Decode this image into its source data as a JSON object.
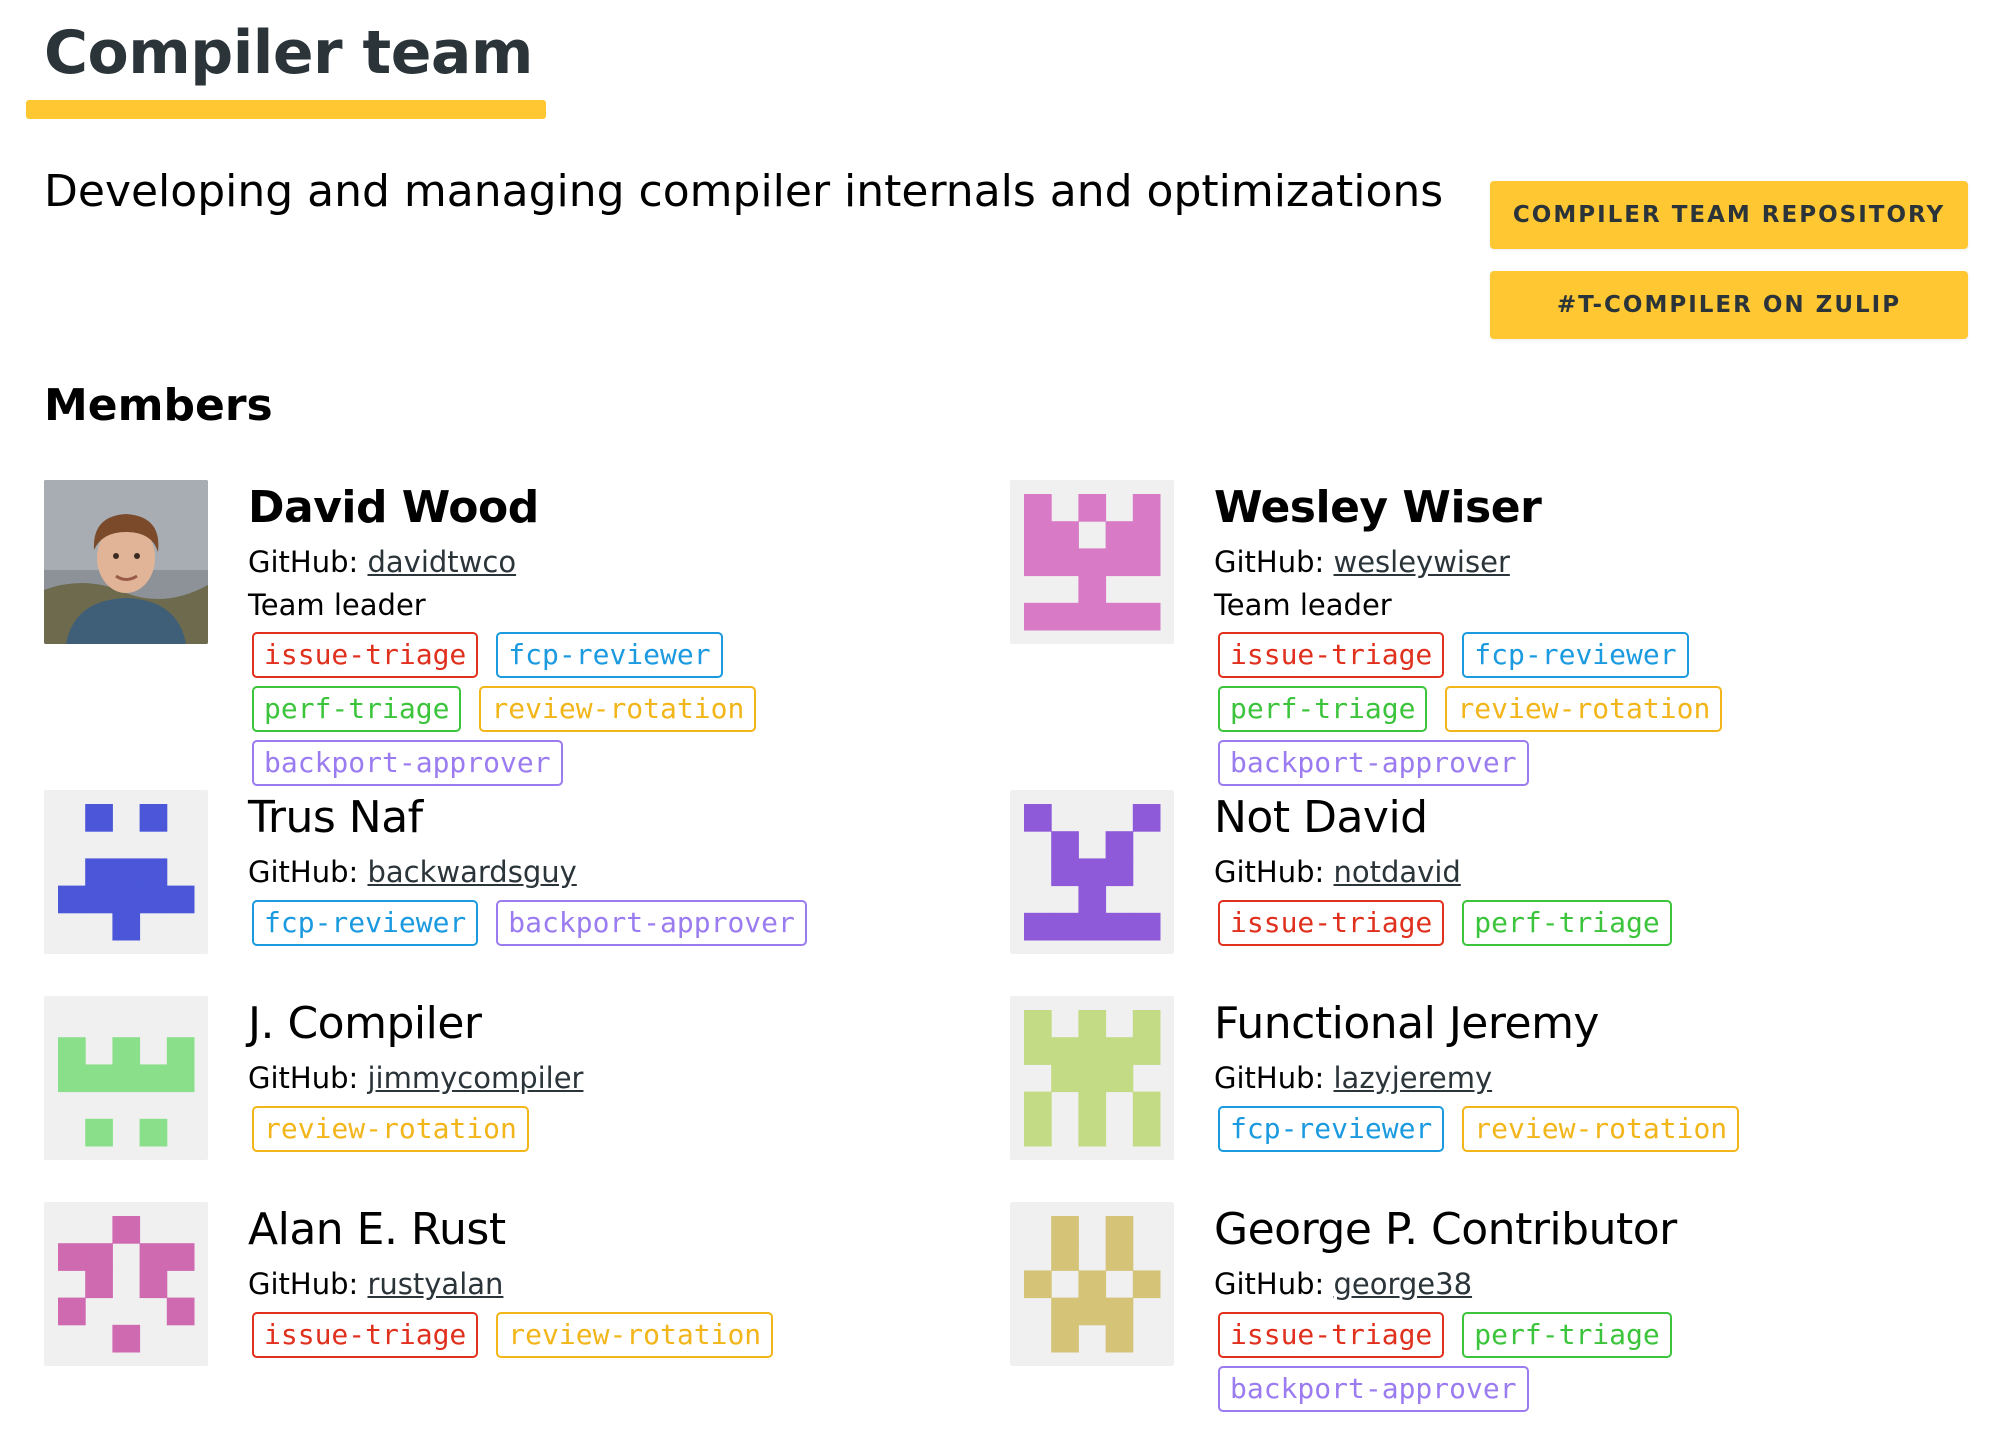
{
  "page": {
    "title": "Compiler team",
    "subtitle": "Developing and managing compiler internals and optimizations"
  },
  "links": [
    {
      "label": "COMPILER TEAM REPOSITORY",
      "name": "compiler-team-repository-button"
    },
    {
      "label": "#T-COMPILER ON ZULIP",
      "name": "zulip-stream-button"
    }
  ],
  "members_heading": "Members",
  "github_prefix": "GitHub: ",
  "tag_colors": {
    "issue-triage": "#e0301e",
    "fcp-reviewer": "#1b9ae0",
    "perf-triage": "#3cc43c",
    "review-rotation": "#f2b51a",
    "backport-approver": "#9b7cf0"
  },
  "members": [
    {
      "name": "David Wood",
      "github": "davidtwco",
      "role": "Team leader",
      "lead": true,
      "avatar": {
        "type": "photo",
        "bg": "#8d9298"
      },
      "tags": [
        "issue-triage",
        "fcp-reviewer",
        "perf-triage",
        "review-rotation",
        "backport-approver"
      ]
    },
    {
      "name": "Wesley Wiser",
      "github": "wesleywiser",
      "role": "Team leader",
      "lead": true,
      "avatar": {
        "type": "identicon",
        "color": "#d97ac6",
        "grid": [
          "10101",
          "11011",
          "11111",
          "00100",
          "11111"
        ]
      },
      "tags": [
        "issue-triage",
        "fcp-reviewer",
        "perf-triage",
        "review-rotation",
        "backport-approver"
      ]
    },
    {
      "name": "Trus Naf",
      "github": "backwardsguy",
      "role": "",
      "lead": false,
      "avatar": {
        "type": "identicon",
        "color": "#4b57d8",
        "grid": [
          "01010",
          "00000",
          "01110",
          "11111",
          "00100"
        ]
      },
      "tags": [
        "fcp-reviewer",
        "backport-approver"
      ]
    },
    {
      "name": "Not David",
      "github": "notdavid",
      "role": "",
      "lead": false,
      "avatar": {
        "type": "identicon",
        "color": "#8e5ad9",
        "grid": [
          "10001",
          "01010",
          "01110",
          "00100",
          "11111"
        ]
      },
      "tags": [
        "issue-triage",
        "perf-triage"
      ]
    },
    {
      "name": "J. Compiler",
      "github": "jimmycompiler",
      "role": "",
      "lead": false,
      "avatar": {
        "type": "identicon",
        "color": "#8ae08a",
        "grid": [
          "00000",
          "10101",
          "11111",
          "00000",
          "01010"
        ]
      },
      "tags": [
        "review-rotation"
      ]
    },
    {
      "name": "Functional Jeremy",
      "github": "lazyjeremy",
      "role": "",
      "lead": false,
      "avatar": {
        "type": "identicon",
        "color": "#c2db84",
        "grid": [
          "10101",
          "11111",
          "01110",
          "10101",
          "10101"
        ]
      },
      "tags": [
        "fcp-reviewer",
        "review-rotation"
      ]
    },
    {
      "name": "Alan E. Rust",
      "github": "rustyalan",
      "role": "",
      "lead": false,
      "avatar": {
        "type": "identicon",
        "color": "#cf69b0",
        "grid": [
          "00100",
          "11011",
          "01010",
          "10001",
          "00100"
        ]
      },
      "tags": [
        "issue-triage",
        "review-rotation"
      ]
    },
    {
      "name": "George P. Contributor",
      "github": "george38",
      "role": "",
      "lead": false,
      "avatar": {
        "type": "identicon",
        "color": "#d5c478",
        "grid": [
          "01010",
          "01010",
          "10101",
          "01110",
          "01010"
        ]
      },
      "tags": [
        "issue-triage",
        "perf-triage",
        "backport-approver"
      ]
    }
  ]
}
